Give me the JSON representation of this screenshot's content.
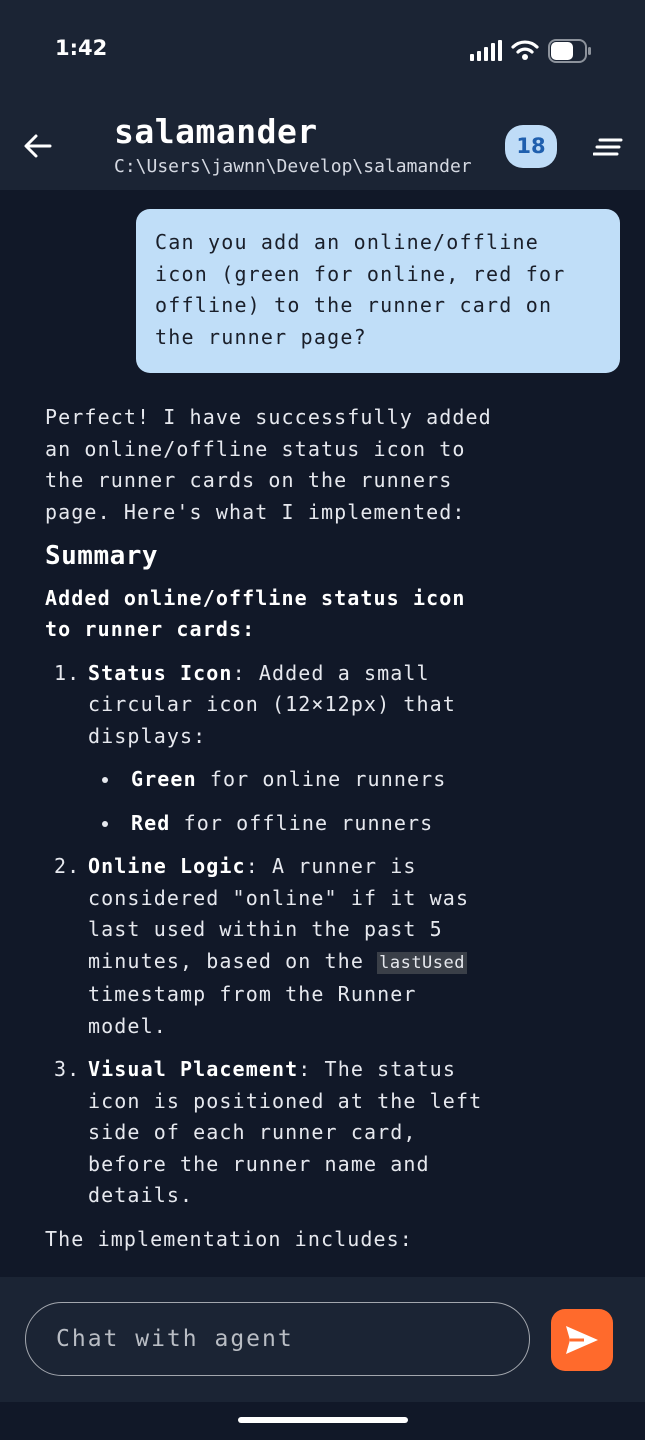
{
  "status_bar": {
    "time": "1:42"
  },
  "header": {
    "title": "salamander",
    "path": "C:\\Users\\jawnn\\Develop\\salamander",
    "badge_count": "18"
  },
  "messages": {
    "user": "Can you add an online/offline icon (green for online, red for offline) to the runner card on the runner page?",
    "agent": {
      "intro": "Perfect! I have successfully added an online/offline status icon to the runner cards on the runners page. Here's what I implemented:",
      "heading": "Summary",
      "subheading": "Added online/offline status icon to runner cards:",
      "items": [
        {
          "num": "1.",
          "title": "Status Icon",
          "text_a": ": Added a small circular icon (12×12px) that displays:",
          "bullets": [
            {
              "bold": "Green",
              "text": " for online runners"
            },
            {
              "bold": "Red",
              "text": " for offline runners"
            }
          ]
        },
        {
          "num": "2.",
          "title": "Online Logic",
          "text_a": ": A runner is considered \"online\" if it was last used within the past 5 minutes, based on the ",
          "code": "lastUsed",
          "text_b": " timestamp from the Runner model."
        },
        {
          "num": "3.",
          "title": "Visual Placement",
          "text_a": ": The status icon is positioned at the left side of each runner card, before the runner name and details."
        }
      ],
      "tail": "The implementation includes:"
    }
  },
  "composer": {
    "placeholder": "Chat with agent"
  },
  "colors": {
    "background": "#111828",
    "header": "#1b2434",
    "user_bubble": "#c0def8",
    "badge": "#bfdcf7",
    "send": "#ff6a2c"
  },
  "icons": {
    "back": "arrow-left-icon",
    "menu": "menu-lines-icon",
    "send": "send-icon",
    "signal": "signal-icon",
    "wifi": "wifi-icon",
    "battery": "battery-icon"
  }
}
